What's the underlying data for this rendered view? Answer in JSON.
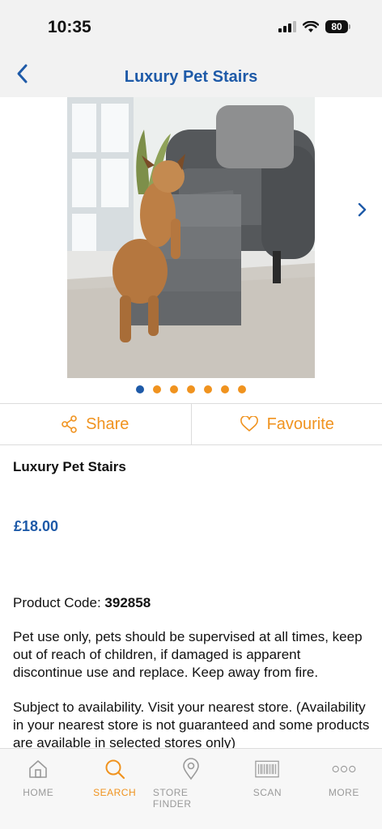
{
  "status": {
    "time": "10:35",
    "battery": "80"
  },
  "nav": {
    "title": "Luxury Pet Stairs"
  },
  "gallery": {
    "page_count": 7,
    "active_page": 1
  },
  "actions": {
    "share": "Share",
    "favourite": "Favourite"
  },
  "product": {
    "name": "Luxury Pet Stairs",
    "price": "£18.00",
    "code_label": "Product Code:",
    "code": "392858",
    "description": "Pet use only, pets should be supervised at all times, keep out of reach of children, if damaged is apparent discontinue use and replace. Keep away from fire.",
    "availability": "Subject to availability. Visit your nearest store. (Availability in your nearest store is not guaranteed and some products are available in selected stores only)"
  },
  "tabs": [
    {
      "label": "HOME",
      "icon": "home-icon"
    },
    {
      "label": "SEARCH",
      "icon": "search-icon"
    },
    {
      "label": "STORE FINDER",
      "icon": "location-pin-icon"
    },
    {
      "label": "SCAN",
      "icon": "barcode-icon"
    },
    {
      "label": "MORE",
      "icon": "more-dots-icon"
    }
  ],
  "colors": {
    "brand_blue": "#1e5aa8",
    "accent_orange": "#f0931f",
    "inactive_grey": "#9a9a9a"
  }
}
